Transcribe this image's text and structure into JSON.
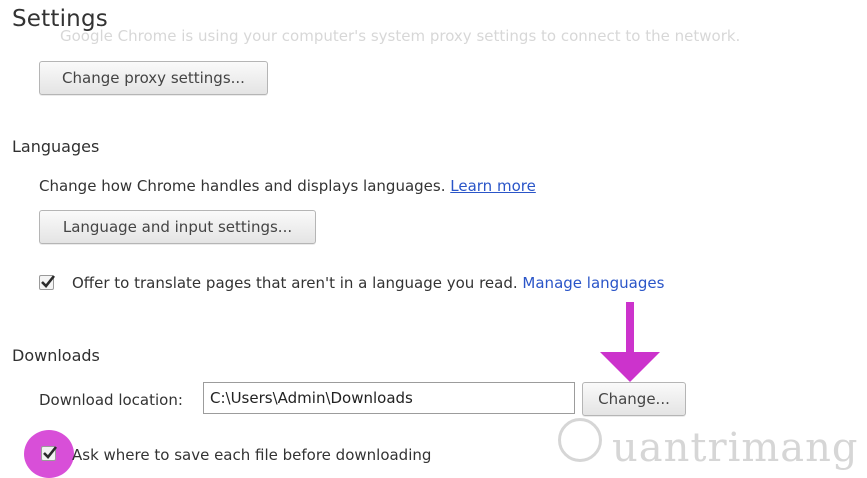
{
  "page": {
    "title": "Settings",
    "ghost_text": "Google Chrome is using your computer's system proxy settings to connect to the network."
  },
  "proxy": {
    "button_label": "Change proxy settings..."
  },
  "languages": {
    "heading": "Languages",
    "description": "Change how Chrome handles and displays languages.",
    "learn_more": "Learn more",
    "button_label": "Language and input settings...",
    "translate_label": "Offer to translate pages that aren't in a language you read.",
    "translate_checked": true,
    "manage_link": "Manage languages"
  },
  "downloads": {
    "heading": "Downloads",
    "location_label": "Download location:",
    "location_value": "C:\\Users\\Admin\\Downloads",
    "change_label": "Change...",
    "ask_label": "Ask where to save each file before downloading",
    "ask_checked": true
  },
  "annotations": {
    "arrow_color": "#cc33cc",
    "highlight_color": "#cc33cc"
  },
  "watermark": {
    "text": "uantrimang"
  }
}
